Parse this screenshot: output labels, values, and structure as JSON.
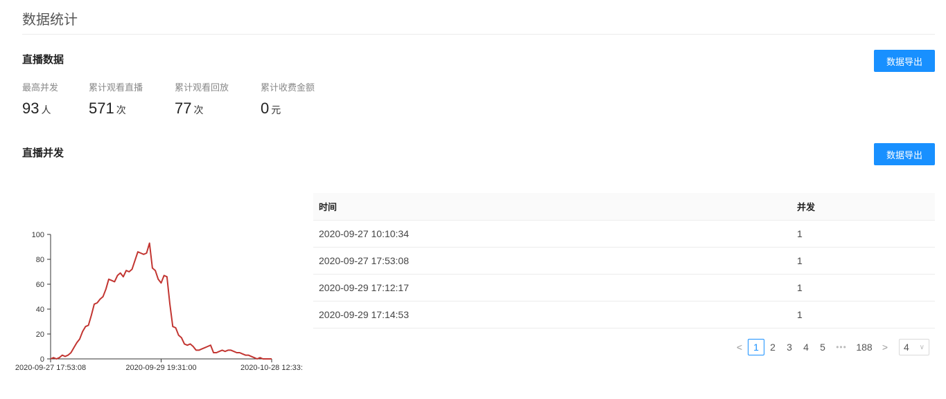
{
  "header": {
    "title": "数据统计"
  },
  "live_data": {
    "title": "直播数据",
    "export_label": "数据导出",
    "stats": [
      {
        "label": "最高并发",
        "value": "93",
        "unit": "人"
      },
      {
        "label": "累计观看直播",
        "value": "571",
        "unit": "次"
      },
      {
        "label": "累计观看回放",
        "value": "77",
        "unit": "次"
      },
      {
        "label": "累计收费金额",
        "value": "0",
        "unit": "元"
      }
    ]
  },
  "concurrency": {
    "title": "直播并发",
    "export_label": "数据导出",
    "table": {
      "columns": [
        "时间",
        "并发"
      ],
      "rows": [
        [
          "2020-09-27 10:10:34",
          "1"
        ],
        [
          "2020-09-27 17:53:08",
          "1"
        ],
        [
          "2020-09-29 17:12:17",
          "1"
        ],
        [
          "2020-09-29 17:14:53",
          "1"
        ]
      ]
    },
    "pagination": {
      "prev": "<",
      "pages": [
        "1",
        "2",
        "3",
        "4",
        "5"
      ],
      "current": "1",
      "ellipsis": "•••",
      "last": "188",
      "next": ">",
      "page_size": "4"
    }
  },
  "colors": {
    "accent": "#1890ff",
    "line": "#c23531"
  },
  "chart_data": {
    "type": "line",
    "ylim": [
      0,
      100
    ],
    "yticks": [
      0,
      20,
      40,
      60,
      80,
      100
    ],
    "x_tick_labels": [
      "2020-09-27 17:53:08",
      "2020-09-29 19:31:00",
      "2020-10-28 12:33:"
    ],
    "x_tick_index": [
      0,
      38,
      76
    ],
    "series": [
      {
        "values": [
          0,
          1,
          0,
          1,
          3,
          2,
          3,
          5,
          9,
          13,
          16,
          22,
          26,
          27,
          35,
          44,
          45,
          48,
          50,
          56,
          64,
          63,
          62,
          67,
          69,
          66,
          71,
          70,
          72,
          79,
          86,
          85,
          84,
          85,
          93,
          73,
          71,
          64,
          61,
          67,
          66,
          44,
          26,
          25,
          19,
          17,
          12,
          11,
          12,
          10,
          7,
          7,
          8,
          9,
          10,
          11,
          5,
          5,
          6,
          7,
          6,
          7,
          7,
          6,
          5,
          5,
          4,
          3,
          3,
          2,
          1,
          0,
          1,
          0,
          0,
          0,
          0
        ]
      }
    ]
  }
}
